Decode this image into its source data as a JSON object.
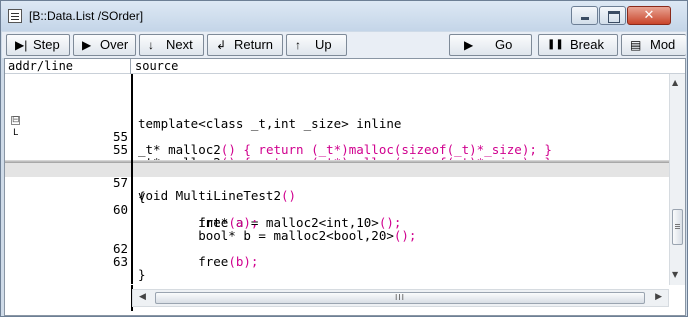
{
  "window": {
    "title": "[B::Data.List /SOrder]",
    "close_glyph": "✕"
  },
  "toolbar": {
    "buttons": [
      {
        "label": "Step",
        "icon": "▶|"
      },
      {
        "label": "Over",
        "icon": "▶"
      },
      {
        "label": "Next",
        "icon": "↓"
      },
      {
        "label": "Return",
        "icon": "↲"
      },
      {
        "label": "Up",
        "icon": "↑"
      },
      {
        "label": "Go",
        "icon": "▶"
      },
      {
        "label": "Break",
        "icon": "❚❚"
      },
      {
        "label": "Mod",
        "icon": "▤"
      }
    ]
  },
  "columns": {
    "addr": "addr/line",
    "source": "source"
  },
  "code": {
    "template_line": "template<class _t,int _size> inline",
    "l55a_num": "55",
    "l55b_num": "55",
    "l57_num": "57",
    "l60_num": "60",
    "l62_num": "62",
    "l63_num": "63",
    "open_brace": "{",
    "close_brace": "}",
    "l60_a": "        int* a = malloc2<int,10>",
    "l60_a_p": "();",
    "free_a": "        free",
    "free_a_p": "(a);",
    "bool_b": "        bool* b = malloc2<bool,20>",
    "bool_b_p": "();",
    "free_b": "        free",
    "free_b_p": "(b);",
    "func": "void MultiLineTest2",
    "func_p": "()",
    "t1": "_t* malloc2",
    "t1_p": "() { return (_t*)malloc(sizeof(_t)*_size); }",
    "fold_glyph": "⊟",
    "fold_end": "L"
  },
  "colors": {
    "cpp_punct": "#d0008e",
    "blue": "#0000c8"
  },
  "scroll": {
    "up": "▲",
    "down": "▼",
    "left": "◀",
    "right": "▶",
    "thumb_grip": "III"
  }
}
